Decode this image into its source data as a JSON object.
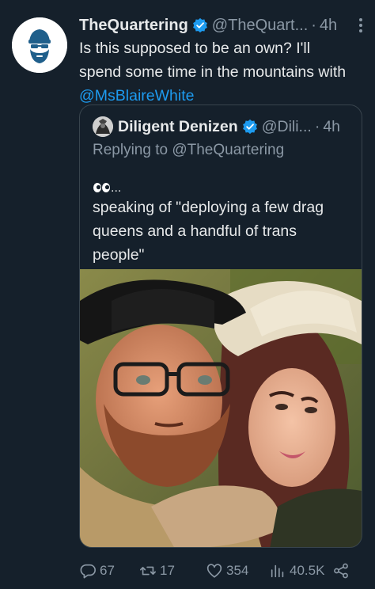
{
  "tweet": {
    "display_name": "TheQuartering",
    "handle": "@TheQuart...",
    "separator": "·",
    "time": "4h",
    "text_lines": [
      "Is this supposed to be an own?  I'll",
      "spend some time in the mountains with"
    ],
    "mention": "@MsBlaireWhite"
  },
  "quote": {
    "display_name": "Diligent Denizen",
    "handle": "@Dili...",
    "separator": "·",
    "time": "4h",
    "replying_prefix": "Replying to",
    "replying_to": "@TheQuartering",
    "eyes_suffix": "...",
    "text_lines": [
      "speaking of \"deploying a few drag",
      "queens and a handful of trans",
      "people\""
    ]
  },
  "actions": {
    "replies": "67",
    "retweets": "17",
    "likes": "354",
    "views": "40.5K"
  },
  "colors": {
    "background": "#15202b",
    "text": "#e7e9ea",
    "muted": "#8b98a5",
    "accent": "#1d9bf0",
    "border": "#38444d"
  },
  "icons": [
    "verified-badge-icon",
    "more-icon",
    "eyes-icon",
    "reply-icon",
    "retweet-icon",
    "like-icon",
    "views-icon",
    "share-icon"
  ]
}
